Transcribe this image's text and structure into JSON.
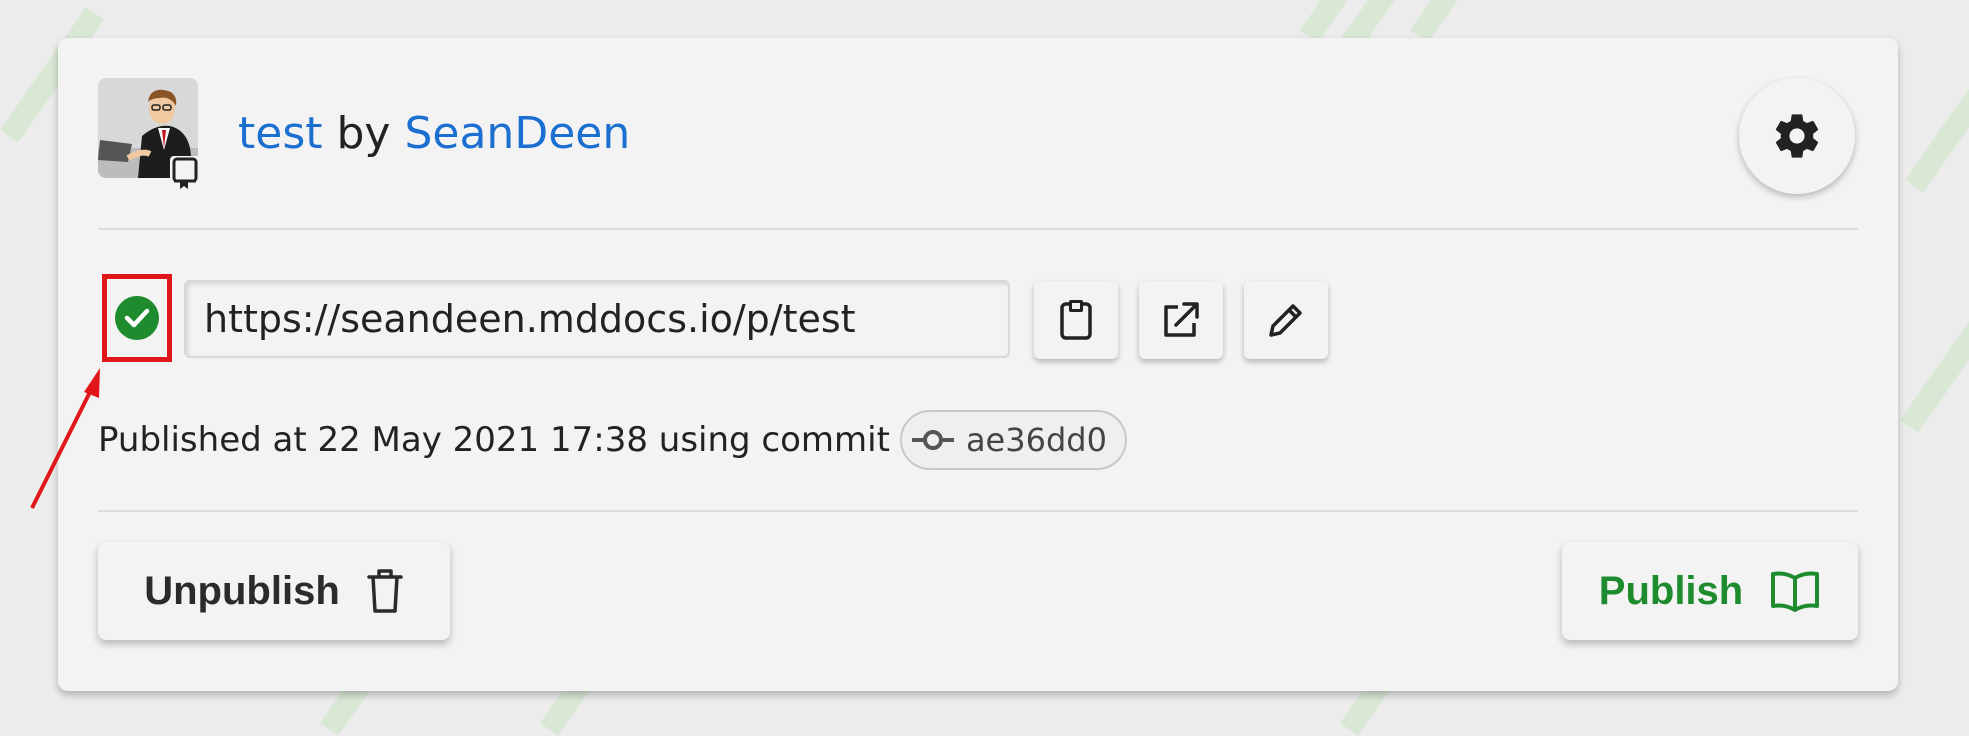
{
  "header": {
    "repo_name": "test",
    "by_label": "by",
    "owner_name": "SeanDeen"
  },
  "publish_url": {
    "value": "https://seandeen.mddocs.io/p/test",
    "status": "published"
  },
  "publish_info": {
    "text": "Published at 22 May 2021 17:38 using commit",
    "commit": "ae36dd0"
  },
  "actions": {
    "unpublish_label": "Unpublish",
    "publish_label": "Publish"
  },
  "icons": {
    "settings": "gear-icon",
    "status": "check-circle-icon",
    "copy": "clipboard-icon",
    "open": "external-link-icon",
    "edit": "pencil-icon",
    "commit": "git-commit-icon",
    "unpublish": "trash-icon",
    "publish": "book-open-icon",
    "repo": "repo-icon"
  },
  "colors": {
    "link": "#1b6fd1",
    "success": "#1e8c2e",
    "highlight": "#e0161b",
    "background": "#ececec",
    "card": "#f3f3f3"
  }
}
